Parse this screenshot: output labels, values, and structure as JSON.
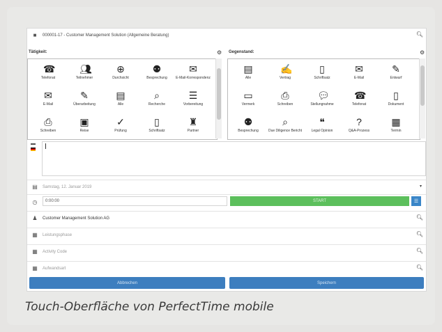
{
  "top": {
    "project": "000001-17 - Customer Management Solution (Allgemeine Beratung)"
  },
  "taetigkeit": {
    "header": "Tätigkeit:",
    "items": [
      {
        "label": "Telefonat",
        "icon": "phone-icon"
      },
      {
        "label": "Teilnehmer",
        "icon": "people-icon"
      },
      {
        "label": "Durchsicht",
        "icon": "zoom-icon"
      },
      {
        "label": "Besprechung",
        "icon": "group-icon"
      },
      {
        "label": "E-Mail-Korrespondenz",
        "icon": "mails-icon"
      },
      {
        "label": "E-Mail",
        "icon": "envelope-icon"
      },
      {
        "label": "Überarbeitung",
        "icon": "pencil-icon"
      },
      {
        "label": "Alle",
        "icon": "documents-icon"
      },
      {
        "label": "Recherche",
        "icon": "search-doc-icon"
      },
      {
        "label": "Vorbereitung",
        "icon": "list-icon"
      },
      {
        "label": "Schreiben",
        "icon": "printer-icon"
      },
      {
        "label": "Reise",
        "icon": "suitcase-icon"
      },
      {
        "label": "Prüfung",
        "icon": "review-icon"
      },
      {
        "label": "Schriftsatz",
        "icon": "file-icon"
      },
      {
        "label": "Partner",
        "icon": "partner-icon"
      }
    ]
  },
  "gegenstand": {
    "header": "Gegenstand:",
    "items": [
      {
        "label": "Alle",
        "icon": "documents-icon"
      },
      {
        "label": "Vertrag",
        "icon": "contract-icon"
      },
      {
        "label": "Schriftsatz",
        "icon": "file-icon"
      },
      {
        "label": "E-Mail",
        "icon": "envelope-icon"
      },
      {
        "label": "Entwurf",
        "icon": "draft-icon"
      },
      {
        "label": "Vermerk",
        "icon": "note-icon"
      },
      {
        "label": "Schreiben",
        "icon": "printer-icon"
      },
      {
        "label": "Stellungnahme",
        "icon": "speech-icon"
      },
      {
        "label": "Telefonat",
        "icon": "phone-icon"
      },
      {
        "label": "Dokument",
        "icon": "document-icon"
      },
      {
        "label": "Besprechung",
        "icon": "group-icon"
      },
      {
        "label": "Due Diligence Bericht",
        "icon": "dd-icon"
      },
      {
        "label": "Legal Opinion",
        "icon": "opinion-icon"
      },
      {
        "label": "Q&A-Prozess",
        "icon": "qa-icon"
      },
      {
        "label": "Termin",
        "icon": "calendar-icon"
      }
    ]
  },
  "fields": {
    "date": "Samstag, 12. Januar 2019",
    "time": "0:00:00",
    "start": "START",
    "client": "Customer Management Solution AG",
    "leistungsphase": "Leistungsphase",
    "activity_code": "Activity Code",
    "aufwandsart": "Aufwandsart"
  },
  "buttons": {
    "cancel": "Abbrechen",
    "save": "Speichern"
  },
  "caption": "Touch-Oberfläche von PerfectTime mobile"
}
